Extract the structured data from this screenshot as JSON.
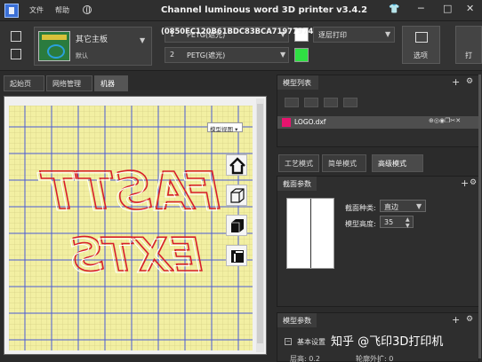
{
  "window": {
    "title": "Channel luminous word 3D printer v3.4.2",
    "menu": {
      "file": "文件",
      "help": "帮助"
    }
  },
  "toolbar": {
    "machine_name": "其它主板",
    "machine_sub": "默认",
    "extruders": [
      {
        "num": "1",
        "material": "PETG(遮光)",
        "color": "#ffffff"
      },
      {
        "num": "2",
        "material": "PETG(遮光)",
        "color": "#2fe043"
      }
    ],
    "serial_overlay": "(0850FC120B61BDC83BCA71977974452F)",
    "print_mode": "逐层打印",
    "options_label": "选项",
    "right_label": "打"
  },
  "left_tabs": [
    "起始页",
    "网络管理",
    "机器"
  ],
  "viewport": {
    "view_select": "模型视图",
    "text_top": "FASTT",
    "text_bottom": "EXTS"
  },
  "model_list": {
    "title": "模型列表",
    "items": [
      {
        "name": "LOGO.dxf",
        "color": "#e6146e"
      }
    ]
  },
  "mode_tabs": [
    "工艺模式",
    "简单模式",
    "高级模式"
  ],
  "section": {
    "title": "截面参数",
    "type_label": "截面种类:",
    "type_value": "直边",
    "height_label": "模型高度:",
    "height_value": "35"
  },
  "model_params": {
    "title": "模型参数",
    "basic_label": "基本设置",
    "row_a": "层高: 0.2",
    "row_b": "轮廓外扩: 0"
  },
  "watermark": "知乎 @飞印3D打印机"
}
